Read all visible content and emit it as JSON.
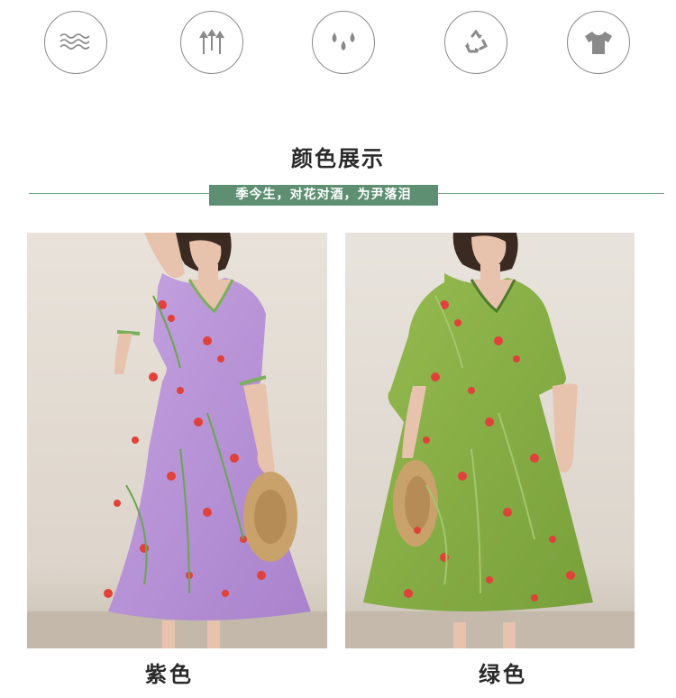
{
  "feature_icons": [
    {
      "icon": "waves-icon"
    },
    {
      "icon": "arrows-up-icon"
    },
    {
      "icon": "water-drops-icon"
    },
    {
      "icon": "recycle-icon"
    },
    {
      "icon": "tshirt-icon"
    }
  ],
  "section": {
    "title": "颜色展示",
    "subtitle": "季今生，对花对酒，为尹落泪"
  },
  "products": [
    {
      "color_label": "紫色",
      "dress_color": "#b48fd3"
    },
    {
      "color_label": "绿色",
      "dress_color": "#86ad45"
    }
  ],
  "colors": {
    "accent": "#5f8f72",
    "icon_gray": "#8a8a8a"
  }
}
